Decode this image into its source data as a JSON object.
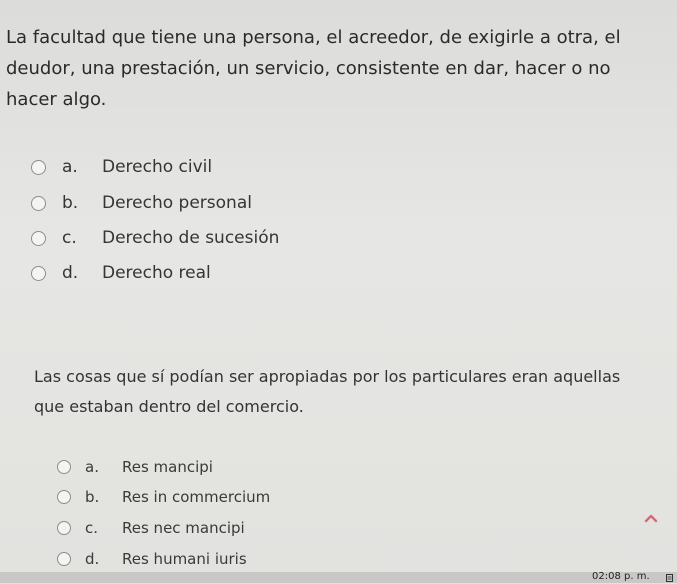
{
  "questions": [
    {
      "text": "La facultad que tiene una persona, el acreedor, de exigirle a otra, el deudor, una prestación, un servicio, consistente en dar, hacer o no hacer algo.",
      "options": [
        {
          "letter": "a.",
          "label": "Derecho civil"
        },
        {
          "letter": "b.",
          "label": "Derecho personal"
        },
        {
          "letter": "c.",
          "label": "Derecho de sucesión"
        },
        {
          "letter": "d.",
          "label": "Derecho real"
        }
      ]
    },
    {
      "text": "Las cosas que sí podían ser apropiadas por los particulares eran aquellas que estaban dentro del comercio.",
      "options": [
        {
          "letter": "a.",
          "label": "Res mancipi"
        },
        {
          "letter": "b.",
          "label": "Res in commercium"
        },
        {
          "letter": "c.",
          "label": "Res nec mancipi"
        },
        {
          "letter": "d.",
          "label": "Res humani iuris"
        }
      ]
    }
  ],
  "scroll_up": {
    "icon": "chevron-up-icon",
    "color": "#d66a7d"
  },
  "taskbar": {
    "clock": "02:08 p. m.",
    "icon": "notification-icon"
  }
}
